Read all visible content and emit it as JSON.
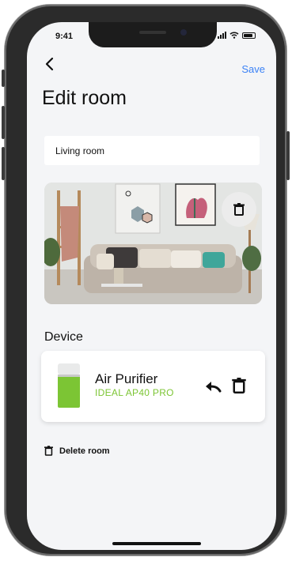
{
  "status_bar": {
    "time": "9:41"
  },
  "header": {
    "back_icon": "chevron-left-icon",
    "save_label": "Save",
    "title": "Edit room"
  },
  "room": {
    "name_value": "Living room"
  },
  "photo": {
    "delete_icon": "trash-icon"
  },
  "device_section": {
    "title": "Device",
    "devices": [
      {
        "name": "Air Purifier",
        "model": "IDEAL AP40 PRO",
        "share_icon": "reply-arrow-icon",
        "delete_icon": "trash-icon"
      }
    ]
  },
  "delete_room": {
    "label": "Delete room",
    "icon": "trash-icon"
  },
  "colors": {
    "accent_blue": "#3b82f6",
    "device_green": "#7cc534",
    "screen_bg": "#f4f5f7"
  }
}
